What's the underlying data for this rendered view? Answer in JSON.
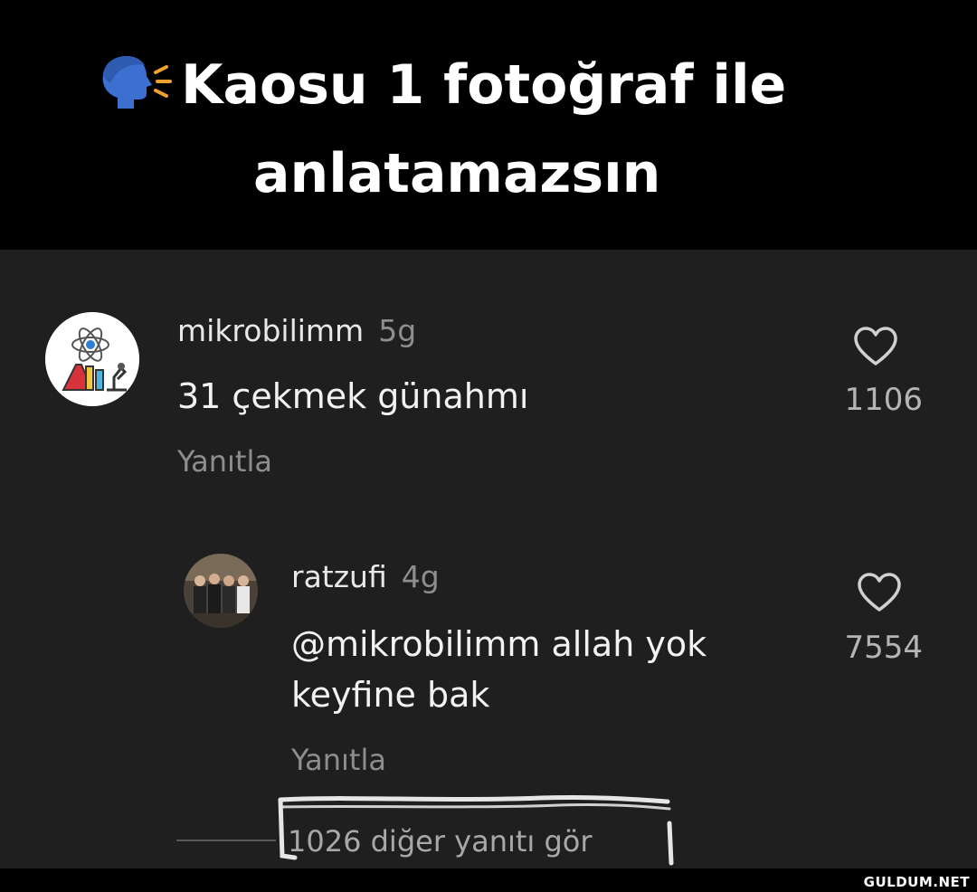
{
  "header": {
    "title_line1": "Kaosu 1 fotoğraf ile",
    "title_line2": "anlatamazsın",
    "icon": "speaking-head-icon"
  },
  "comments": [
    {
      "username": "mikrobilimm",
      "time": "5g",
      "text": "31 çekmek günahmı",
      "reply_label": "Yanıtla",
      "likes": "1106",
      "avatar_icon": "science-lab-icon"
    },
    {
      "username": "ratzufi",
      "time": "4g",
      "text_line1": "@mikrobilimm allah yok",
      "text_line2": "keyfine bak",
      "reply_label": "Yanıtla",
      "likes": "7554",
      "avatar_icon": "group-photo-avatar"
    }
  ],
  "more_replies": "1026 diğer yanıtı gör",
  "watermark": "GULDUM.NET",
  "colors": {
    "background": "#1f1f1f",
    "header_bg": "#000000",
    "text": "#f2f2f2",
    "muted": "#8e8e8e"
  }
}
